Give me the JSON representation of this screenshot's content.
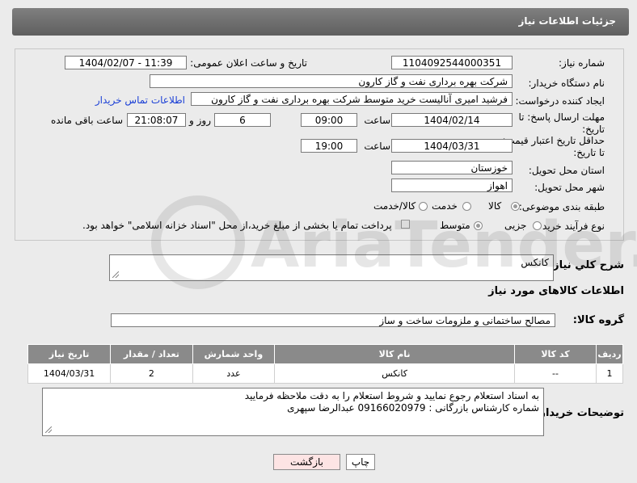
{
  "header": {
    "title": "جزئیات اطلاعات نیاز"
  },
  "form": {
    "need_number": {
      "label": "شماره نیاز:",
      "value": "1104092544000351"
    },
    "announce": {
      "label": "تاریخ و ساعت اعلان عمومی:",
      "value": "1404/02/07 - 11:39"
    },
    "buyer": {
      "label": "نام دستگاه خریدار:",
      "value": "شرکت بهره برداری نفت و گاز کارون"
    },
    "creator": {
      "label": "ایجاد کننده درخواست:",
      "value": "فرشید امیری آنالیست خرید متوسط شرکت بهره برداری نفت و گاز کارون",
      "contact_link": "اطلاعات تماس خریدار"
    },
    "deadline": {
      "label": "مهلت ارسال پاسخ: تا تاریخ:",
      "date": "1404/02/14",
      "time_label": "ساعت",
      "time": "09:00",
      "days": "6",
      "days_label": "روز و",
      "remaining": "21:08:07",
      "remaining_label": "ساعت باقی مانده"
    },
    "validity": {
      "label": "حداقل تاریخ اعتبار قیمت: تا تاریخ:",
      "date": "1404/03/31",
      "time_label": "ساعت",
      "time": "19:00"
    },
    "province": {
      "label": "استان محل تحویل:",
      "value": "خوزستان"
    },
    "city": {
      "label": "شهر محل تحویل:",
      "value": "اهواز"
    },
    "category": {
      "label": "طبقه بندی موضوعی:",
      "options": [
        "کالا",
        "خدمت",
        "کالا/خدمت"
      ]
    },
    "process": {
      "label": "نوع فرآیند خرید :",
      "options": [
        "جزیی",
        "متوسط"
      ],
      "payment_note": "پرداخت تمام یا بخشی از مبلغ خرید،از محل \"اسناد خزانه اسلامی\" خواهد بود."
    }
  },
  "summary": {
    "label": "شرح کلي نياز:",
    "value": "کانکس"
  },
  "items_title": "اطلاعات کالاهای مورد نیاز",
  "goods_group": {
    "label": "گروه کالا:",
    "value": "مصالح ساختمانی و ملزومات ساخت و ساز"
  },
  "table": {
    "headers": [
      "ردیف",
      "کد کالا",
      "نام کالا",
      "واحد شمارش",
      "تعداد / مقدار",
      "تاریخ نیاز"
    ],
    "rows": [
      [
        "1",
        "--",
        "کانکس",
        "عدد",
        "2",
        "1404/03/31"
      ]
    ]
  },
  "buyer_notes": {
    "label": "توضیحات خریدار:",
    "line1": "به اسناد استعلام رجوع نمایید و شروط استعلام را به دقت ملاحظه فرمایید",
    "line2": "شماره کارشناس بازرگانی : 09166020979 عبدالرضا سپهری"
  },
  "buttons": {
    "print": "چاپ",
    "back": "بازگشت"
  },
  "watermark": {
    "text": "AriaTender.neT"
  }
}
